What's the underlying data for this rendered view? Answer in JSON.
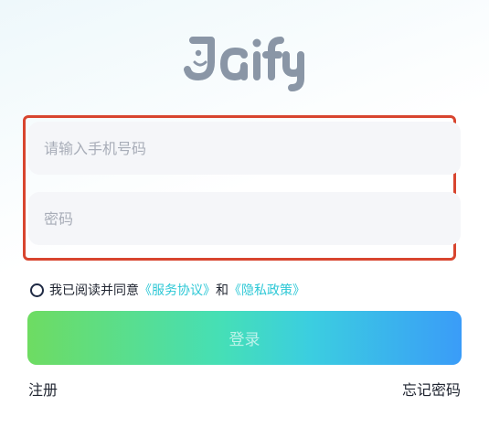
{
  "brand": {
    "logo_text": "Jaify",
    "logo_color": "#8a96a6"
  },
  "form": {
    "phone_placeholder": "请输入手机号码",
    "password_placeholder": "密码",
    "highlight_color": "#d8452f",
    "field_bg": "#f5f6f9"
  },
  "agreement": {
    "prefix": "我已阅读并同意",
    "service_link": "《服务协议》",
    "conjunction": "和",
    "privacy_link": "《隐私政策》",
    "link_color": "#2ec8d6",
    "checked": false
  },
  "actions": {
    "login_label": "登录",
    "register_label": "注册",
    "forgot_label": "忘记密码"
  }
}
